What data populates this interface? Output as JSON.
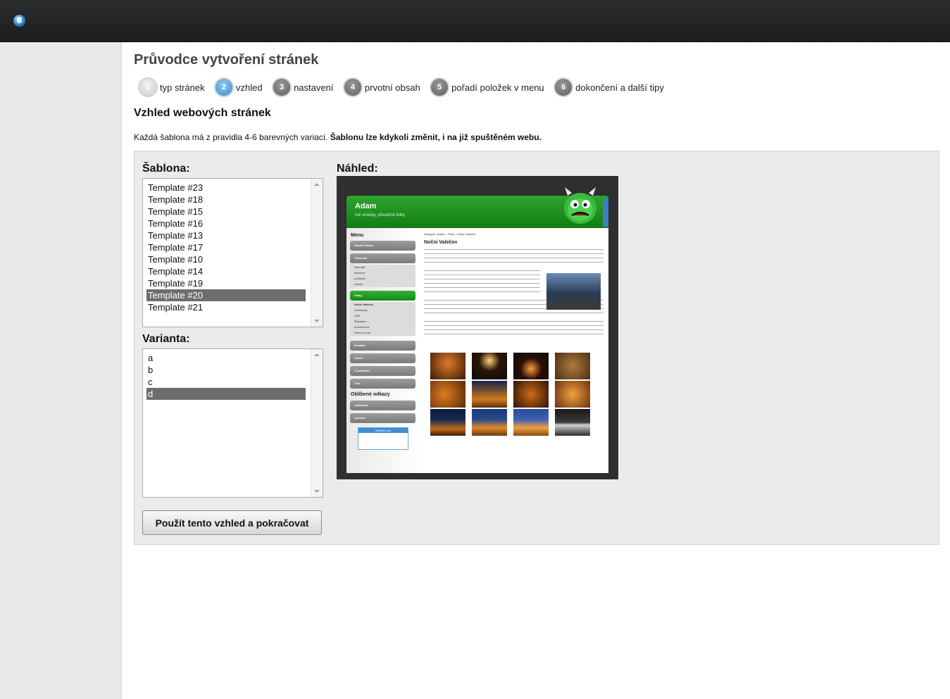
{
  "wizard": {
    "title": "Průvodce vytvoření stránek",
    "steps": [
      {
        "number": "1",
        "label": "typ stránek",
        "state": "done"
      },
      {
        "number": "2",
        "label": "vzhled",
        "state": "active"
      },
      {
        "number": "3",
        "label": "nastavení",
        "state": "pending"
      },
      {
        "number": "4",
        "label": "prvotní obsah",
        "state": "pending"
      },
      {
        "number": "5",
        "label": "pořadí položek v menu",
        "state": "pending"
      },
      {
        "number": "6",
        "label": "dokončení a další tipy",
        "state": "pending"
      }
    ]
  },
  "section": {
    "title": "Vzhled webových stránek",
    "intro_text": "Každá šablona má z pravidla 4-6 barevných variací. ",
    "intro_bold": "Šablonu lze kdykoli změnit, i na již spuštěném webu."
  },
  "template_select": {
    "label": "Šablona:",
    "options": [
      "Template #23",
      "Template #18",
      "Template #15",
      "Template #16",
      "Template #13",
      "Template #17",
      "Template #10",
      "Template #14",
      "Template #19",
      "Template #20",
      "Template #21"
    ],
    "selected": "Template #20"
  },
  "variant_select": {
    "label": "Varianta:",
    "options": [
      "a",
      "b",
      "c",
      "d"
    ],
    "selected": "d"
  },
  "preview": {
    "label": "Náhled:",
    "site_title": "Adam",
    "site_subtitle": "mé stránky, převážně fotky",
    "menu_heading": "Menu",
    "menu_items": [
      "Úvodní strana",
      "Testování",
      "Fotky",
      "Kontakt",
      "návod",
      "K pokusům",
      "Tisk"
    ],
    "submenu_testovani": [
      "kalendář",
      "minichat",
      "počitadlo",
      "anketa"
    ],
    "submenu_fotky": [
      "Noční Valečov",
      "netstranky",
      "HDR",
      "Šejcarsko",
      "Architektura",
      "Oheň a voda"
    ],
    "favorites_heading": "Oblíbené odkazy",
    "favorites_items": [
      "netstránky",
      "rychlost"
    ],
    "counter_title": "Návštěvnost",
    "breadcrumb": "Navigace: Adam » Fotky » Noční Valečov",
    "content_heading": "Noční Valečov"
  },
  "actions": {
    "continue_label": "Použít tento vzhled a pokračovat"
  },
  "colors": {
    "topbar": "#1f2022",
    "accent_blue": "#3b8ccc",
    "selection": "#6d6d6d",
    "preview_green": "#1f8f1f"
  }
}
